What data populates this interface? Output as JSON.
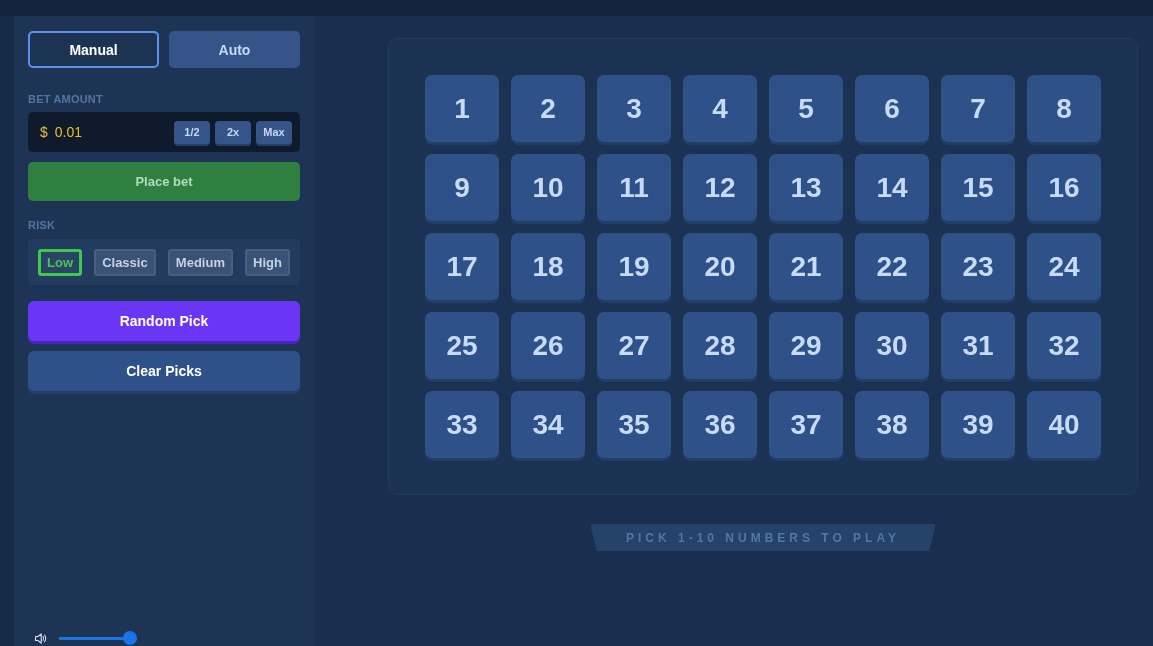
{
  "sidebar": {
    "mode_tabs": [
      {
        "label": "Manual",
        "selected": true
      },
      {
        "label": "Auto",
        "selected": false
      }
    ],
    "bet_amount": {
      "label": "BET AMOUNT",
      "currency": "$",
      "value": "0.01",
      "buttons": [
        "1/2",
        "2x",
        "Max"
      ]
    },
    "place_bet_button": {
      "label": "Place bet",
      "disabled": true
    },
    "risk": {
      "label": "RISK",
      "options": [
        {
          "label": "Low",
          "selected": true
        },
        {
          "label": "Classic",
          "selected": false
        },
        {
          "label": "Medium",
          "selected": false
        },
        {
          "label": "High",
          "selected": false
        }
      ]
    },
    "random_pick_button": "Random Pick",
    "clear_picks_button": "Clear Picks",
    "volume": {
      "level": 1
    }
  },
  "board": {
    "tiles": [
      {
        "label": "1",
        "selected": false
      },
      {
        "label": "2",
        "selected": false
      },
      {
        "label": "3",
        "selected": false
      },
      {
        "label": "4",
        "selected": false
      },
      {
        "label": "5",
        "selected": false
      },
      {
        "label": "6",
        "selected": false
      },
      {
        "label": "7",
        "selected": false
      },
      {
        "label": "8",
        "selected": false
      },
      {
        "label": "9",
        "selected": false
      },
      {
        "label": "10",
        "selected": false
      },
      {
        "label": "11",
        "selected": false
      },
      {
        "label": "12",
        "selected": false
      },
      {
        "label": "13",
        "selected": false
      },
      {
        "label": "14",
        "selected": false
      },
      {
        "label": "15",
        "selected": false
      },
      {
        "label": "16",
        "selected": false
      },
      {
        "label": "17",
        "selected": false
      },
      {
        "label": "18",
        "selected": false
      },
      {
        "label": "19",
        "selected": false
      },
      {
        "label": "20",
        "selected": false
      },
      {
        "label": "21",
        "selected": false
      },
      {
        "label": "22",
        "selected": false
      },
      {
        "label": "23",
        "selected": false
      },
      {
        "label": "24",
        "selected": false
      },
      {
        "label": "25",
        "selected": false
      },
      {
        "label": "26",
        "selected": false
      },
      {
        "label": "27",
        "selected": false
      },
      {
        "label": "28",
        "selected": false
      },
      {
        "label": "29",
        "selected": false
      },
      {
        "label": "30",
        "selected": false
      },
      {
        "label": "31",
        "selected": false
      },
      {
        "label": "32",
        "selected": false
      },
      {
        "label": "33",
        "selected": false
      },
      {
        "label": "34",
        "selected": false
      },
      {
        "label": "35",
        "selected": false
      },
      {
        "label": "36",
        "selected": false
      },
      {
        "label": "37",
        "selected": false
      },
      {
        "label": "38",
        "selected": false
      },
      {
        "label": "39",
        "selected": false
      },
      {
        "label": "40",
        "selected": false
      }
    ],
    "message": "PICK 1-10 NUMBERS TO PLAY"
  }
}
